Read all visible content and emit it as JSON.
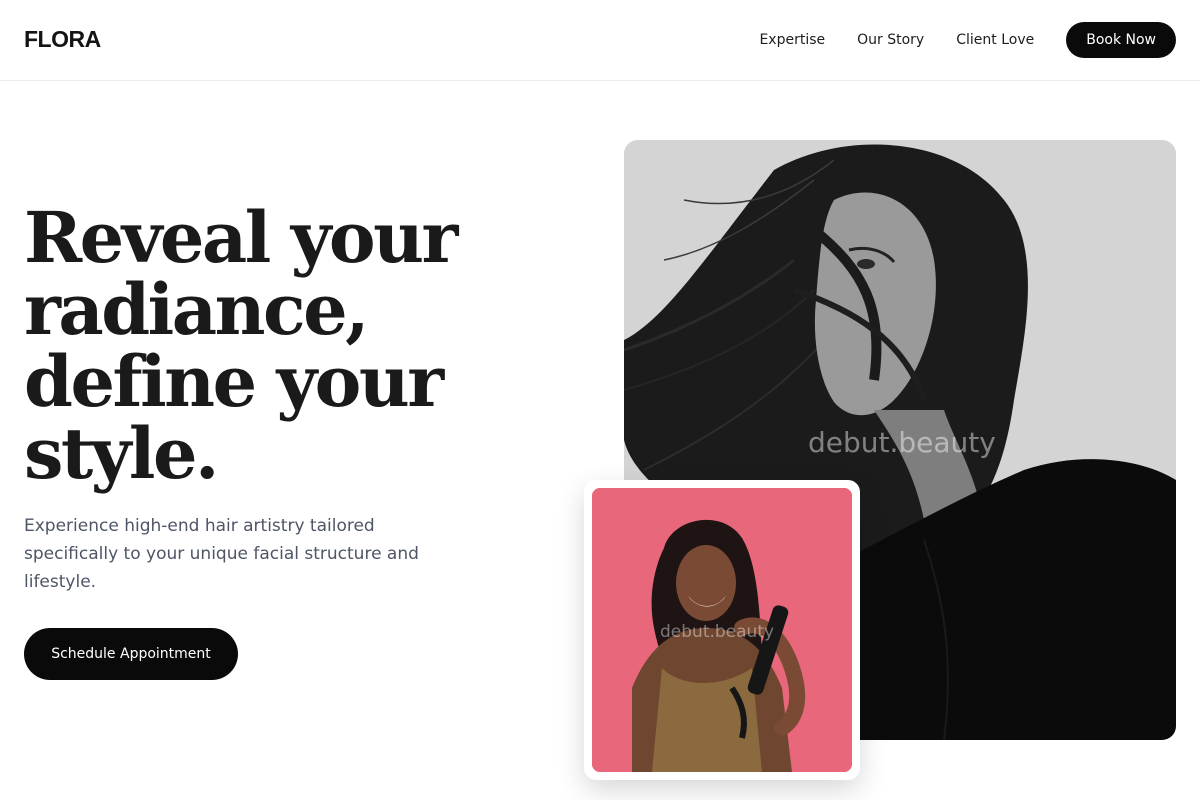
{
  "header": {
    "brand": "FLORA",
    "nav": [
      "Expertise",
      "Our Story",
      "Client Love"
    ],
    "book_label": "Book Now"
  },
  "hero": {
    "headline": "Reveal your radiance, define your style.",
    "subtext": "Experience high-end hair artistry tailored specifically to your unique facial structure and lifestyle.",
    "cta_label": "Schedule Appointment"
  },
  "images": {
    "main_watermark": "debut.beauty",
    "card_watermark": "debut.beauty"
  },
  "colors": {
    "button_bg": "#0a0a0a",
    "card_bg": "#e8677b",
    "text_muted": "#4d5566"
  }
}
